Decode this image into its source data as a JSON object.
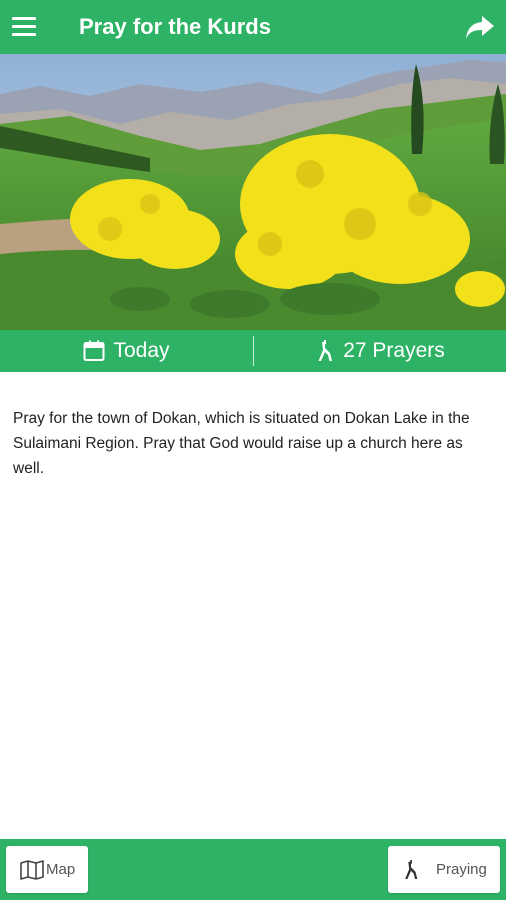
{
  "header": {
    "title": "Pray for the Kurds",
    "menu_icon": "hamburger-menu-icon",
    "share_icon": "share-arrow-icon"
  },
  "hero": {
    "icon": "landscape-photo",
    "description_colors": {
      "sky": "#bcd3e6",
      "mountains": "#8f97a8",
      "grass": "#4e9b35",
      "flowers": "#f2e01a"
    }
  },
  "stats": {
    "date_label": "Today",
    "date_icon": "calendar-icon",
    "prayers_label": "27 Prayers",
    "prayers_icon": "praying-person-icon"
  },
  "content": {
    "text": "Pray for the town of Dokan, which is situated on Dokan Lake in the Sulaimani Region. Pray that God would raise up a church here as well."
  },
  "footer": {
    "map_label": "Map",
    "map_icon": "map-icon",
    "praying_label": "Praying",
    "praying_icon": "praying-person-icon"
  },
  "colors": {
    "accent": "#2eb366",
    "text": "#222222"
  }
}
